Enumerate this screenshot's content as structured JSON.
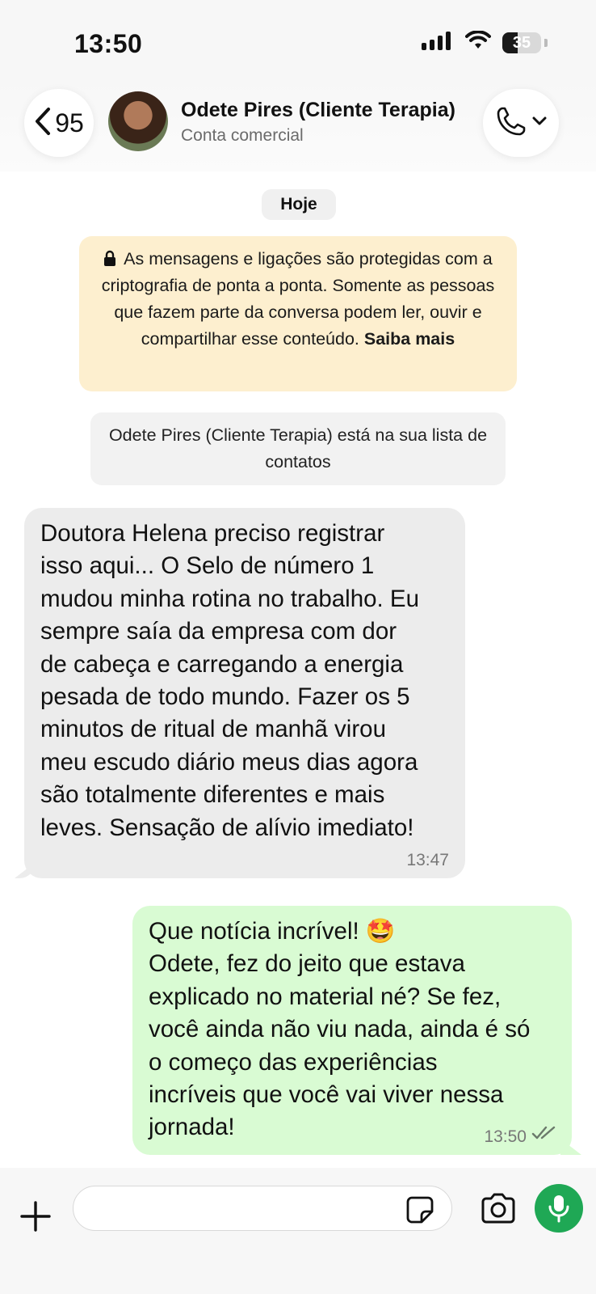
{
  "status_bar": {
    "time": "13:50",
    "battery": "35",
    "icons": [
      "signal-icon",
      "wifi-icon",
      "battery-icon"
    ]
  },
  "header": {
    "back_count": "95",
    "contact_name": "Odete Pires (Cliente Terapia)",
    "contact_subtitle": "Conta comercial"
  },
  "chat": {
    "date_chip": "Hoje",
    "e2e_notice": "As mensagens e ligações são protegidas com a criptografia de ponta a ponta. Somente as pessoas que fazem parte da conversa podem ler, ouvir e compartilhar esse conteúdo.",
    "e2e_link": "Saiba mais",
    "contact_note": "Odete Pires (Cliente Terapia) está na sua lista de contatos",
    "messages": [
      {
        "direction": "incoming",
        "text": "Doutora Helena preciso registrar\nisso aqui... O Selo de número 1\nmudou minha rotina no trabalho. Eu\nsempre saía da empresa com dor\nde cabeça e carregando a energia\npesada de todo mundo. Fazer os 5\nminutos de ritual de manhã virou\nmeu escudo diário meus dias agora\nsão totalmente diferentes e mais\nleves. Sensação de alívio imediato!",
        "time": "13:47"
      },
      {
        "direction": "outgoing",
        "text": "Que notícia incrível! 🤩\nOdete, fez do jeito que estava\nexplicado no material né? Se fez,\nvocê ainda não viu nada, ainda é só\no começo das experiências\nincríveis que você vai viver nessa\njornada!",
        "time": "13:50",
        "status": "read"
      }
    ]
  },
  "input_bar": {
    "value": "",
    "mic_color": "#1fa855"
  },
  "colors": {
    "outgoing_bubble": "#d9fbd3",
    "incoming_bubble": "#ececec",
    "e2e_background": "#fdefcf"
  }
}
